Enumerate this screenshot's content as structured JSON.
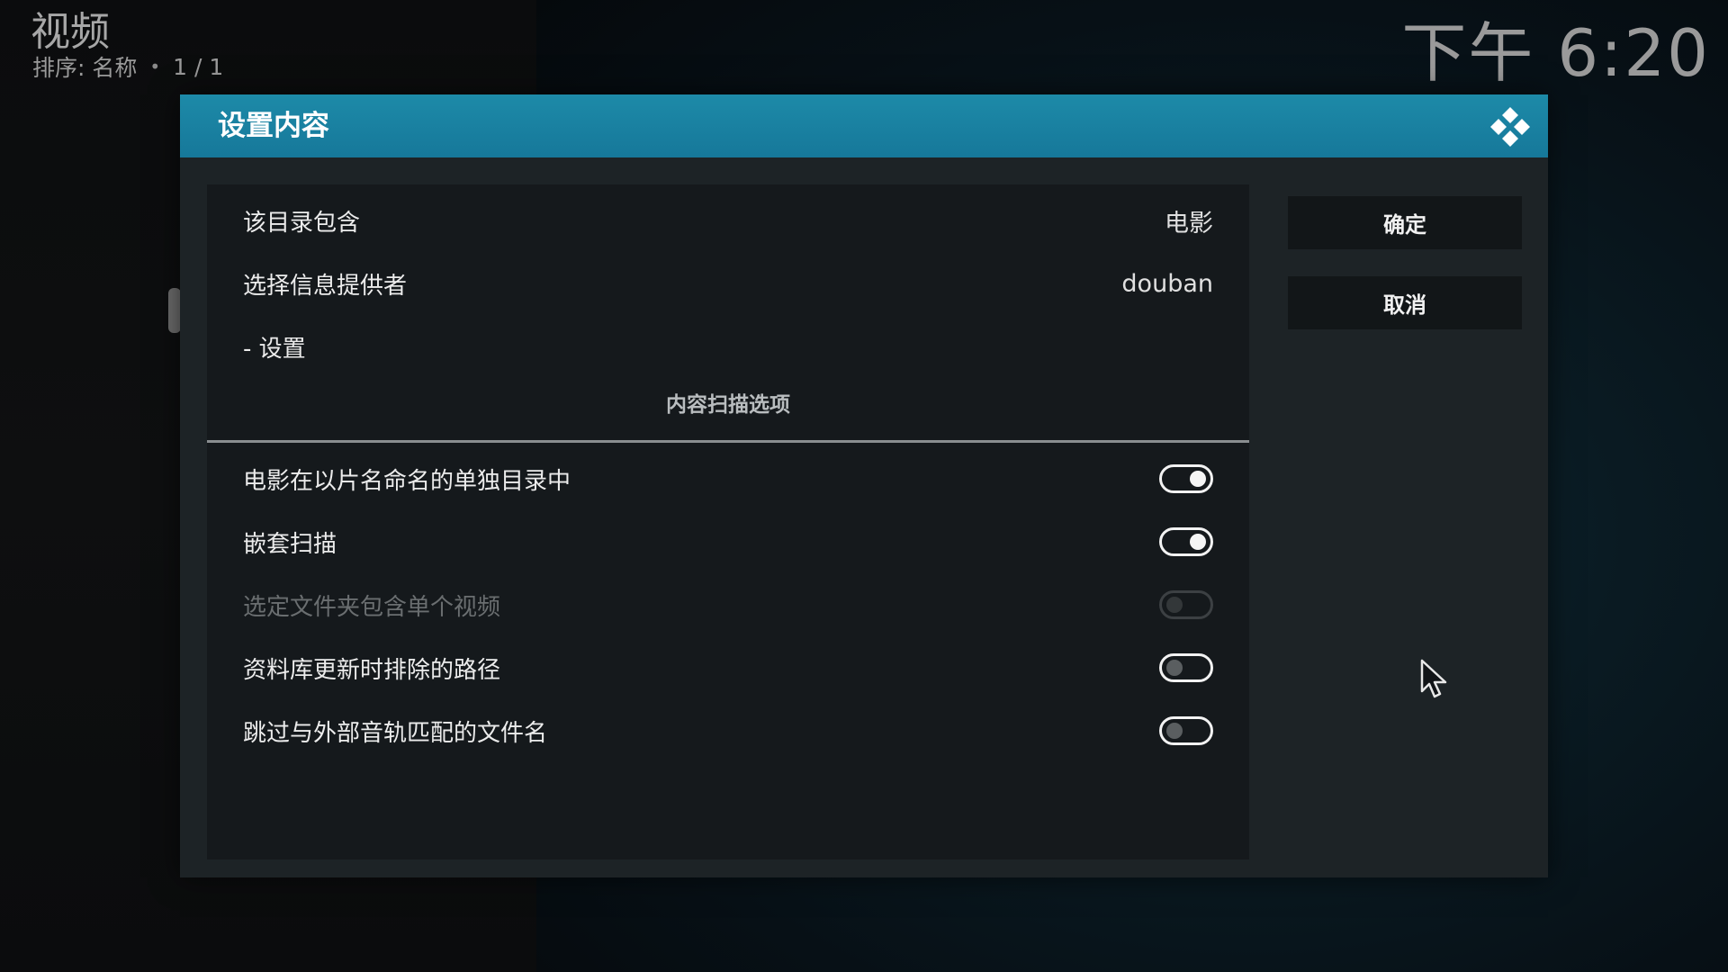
{
  "header": {
    "title": "视频",
    "sort_label": "排序: 名称",
    "separator": "•",
    "page_count": "1 / 1",
    "clock": "下午 6:20"
  },
  "dialog": {
    "title": "设置内容",
    "logo": "kodi-logo-icon",
    "rows": [
      {
        "label": "该目录包含",
        "value": "电影"
      },
      {
        "label": "选择信息提供者",
        "value": "douban"
      },
      {
        "label": "- 设置"
      }
    ],
    "section_header": "内容扫描选项",
    "options": [
      {
        "label": "电影在以片名命名的单独目录中",
        "state": "on",
        "enabled": true
      },
      {
        "label": "嵌套扫描",
        "state": "on",
        "enabled": true
      },
      {
        "label": "选定文件夹包含单个视频",
        "state": "off",
        "enabled": false
      },
      {
        "label": "资料库更新时排除的路径",
        "state": "off",
        "enabled": true
      },
      {
        "label": "跳过与外部音轨匹配的文件名",
        "state": "off",
        "enabled": true
      }
    ],
    "buttons": {
      "ok": "确定",
      "cancel": "取消"
    }
  },
  "colors": {
    "header_accent": "#1a82a2",
    "dialog_bg": "#1d2326",
    "panel_bg": "#15191c"
  }
}
